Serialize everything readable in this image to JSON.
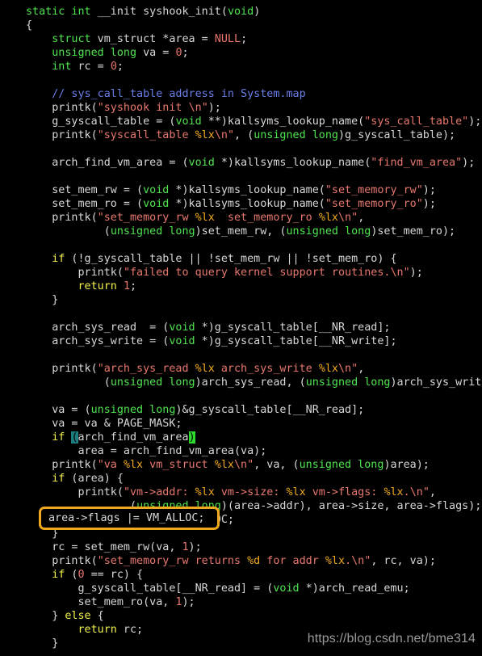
{
  "editor": {
    "background_color": "#000000",
    "foreground_color": "#d8d8d8",
    "language": "C",
    "font_family_kind": "monospace"
  },
  "theme_colors": {
    "type_keyword": "#4ee44e",
    "control_keyword": "#f2f24a",
    "string": "#e8776e",
    "format_specifier": "#f0a81e",
    "number": "#e8776e",
    "comment": "#6a7ee8",
    "plain_text": "#d8d8d8",
    "paren_match_open_bg": "#1d7d7d",
    "paren_match_close_bg": "#2ddb2d",
    "annotation_border": "#f0a81e",
    "watermark": "#a6a6a6"
  },
  "annotation": {
    "kind": "rounded-rectangle-highlight",
    "color": "#f0a81e",
    "target_text": "area->flags |= VM_ALLOC;"
  },
  "watermark": {
    "text": "https://blog.csdn.net/bme314"
  },
  "code": {
    "lines": [
      "static int __init syshook_init(void)",
      "{",
      "    struct vm_struct *area = NULL;",
      "    unsigned long va = 0;",
      "    int rc = 0;",
      "",
      "    // sys_call_table address in System.map",
      "    printk(\"syshook init \\n\");",
      "    g_syscall_table = (void **)kallsyms_lookup_name(\"sys_call_table\");",
      "    printk(\"syscall_table %lx\\n\", (unsigned long)g_syscall_table);",
      "",
      "    arch_find_vm_area = (void *)kallsyms_lookup_name(\"find_vm_area\");",
      "",
      "    set_mem_rw = (void *)kallsyms_lookup_name(\"set_memory_rw\");",
      "    set_mem_ro = (void *)kallsyms_lookup_name(\"set_memory_ro\");",
      "    printk(\"set_memory_rw %lx  set_memory_ro %lx\\n\",",
      "            (unsigned long)set_mem_rw, (unsigned long)set_mem_ro);",
      "",
      "    if (!g_syscall_table || !set_mem_rw || !set_mem_ro) {",
      "        printk(\"failed to query kernel support routines.\\n\");",
      "        return 1;",
      "    }",
      "",
      "    arch_sys_read  = (void *)g_syscall_table[__NR_read];",
      "    arch_sys_write = (void *)g_syscall_table[__NR_write];",
      "",
      "    printk(\"arch_sys_read %lx arch_sys_write %lx\\n\",",
      "            (unsigned long)arch_sys_read, (unsigned long)arch_sys_write);",
      "",
      "    va = (unsigned long)&g_syscall_table[__NR_read];",
      "    va = va & PAGE_MASK;",
      "    if (arch_find_vm_area)",
      "        area = arch_find_vm_area(va);",
      "    printk(\"va %lx vm_struct %lx\\n\", va, (unsigned long)area);",
      "    if (area) {",
      "        printk(\"vm->addr: %lx vm->size: %lx vm->flags: %lx.\\n\",",
      "                (unsigned long)(area->addr), area->size, area->flags);",
      "        area->flags |= VM_ALLOC;",
      "    }",
      "    rc = set_mem_rw(va, 1);",
      "    printk(\"set_memory_rw returns %d for addr %lx.\\n\", rc, va);",
      "    if (0 == rc) {",
      "        g_syscall_table[__NR_read] = (void *)arch_read_emu;",
      "        set_mem_ro(va, 1);",
      "    } else {",
      "        return rc;",
      "    }"
    ],
    "boxed_line_text": "    area->flags |= VM_ALLOC;"
  }
}
